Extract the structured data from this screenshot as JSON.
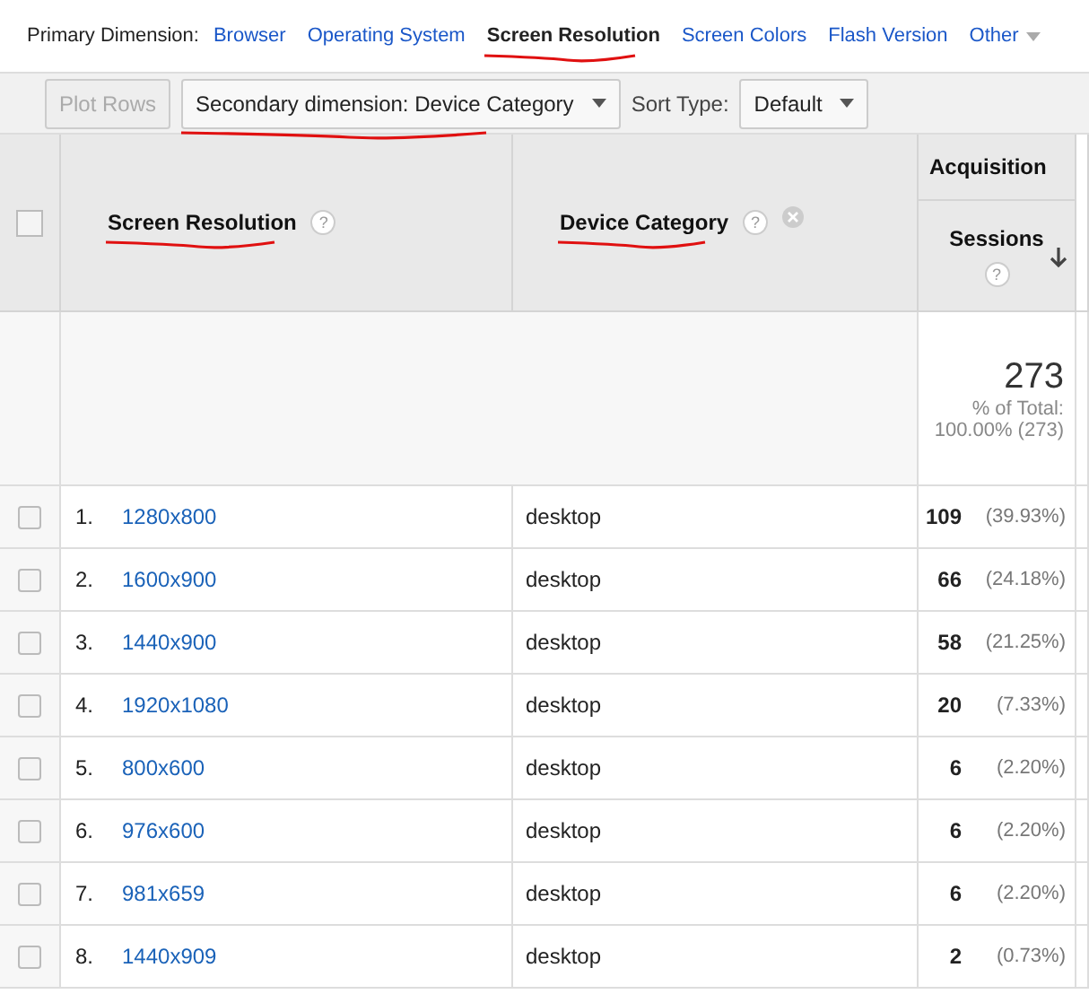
{
  "primary_dimension": {
    "label": "Primary Dimension:",
    "options": [
      {
        "label": "Browser",
        "selected": false
      },
      {
        "label": "Operating System",
        "selected": false
      },
      {
        "label": "Screen Resolution",
        "selected": true
      },
      {
        "label": "Screen Colors",
        "selected": false
      },
      {
        "label": "Flash Version",
        "selected": false
      },
      {
        "label": "Other",
        "selected": false
      }
    ]
  },
  "toolbar": {
    "plot_rows": {
      "label": "Plot Rows",
      "disabled": true
    },
    "secondary_dimension": "Secondary dimension: Device Category",
    "sort_type_label": "Sort Type:",
    "sort_type": "Default"
  },
  "table": {
    "select_all_checked": false,
    "columns": [
      {
        "label": "Screen Resolution",
        "help": "?"
      },
      {
        "label": "Device Category",
        "help": "?"
      }
    ],
    "group_header": "Acquisition",
    "metric_column": {
      "label": "Sessions",
      "help": "?"
    },
    "total": {
      "value": "273",
      "label": "% of Total:",
      "detail": "100.00% (273)"
    },
    "rows": [
      {
        "index": "1.",
        "resolution": "1280x800",
        "device": "desktop",
        "sessions": "109",
        "percent": "(39.93%)",
        "checked": false
      },
      {
        "index": "2.",
        "resolution": "1600x900",
        "device": "desktop",
        "sessions": "66",
        "percent": "(24.18%)",
        "checked": false
      },
      {
        "index": "3.",
        "resolution": "1440x900",
        "device": "desktop",
        "sessions": "58",
        "percent": "(21.25%)",
        "checked": false
      },
      {
        "index": "4.",
        "resolution": "1920x1080",
        "device": "desktop",
        "sessions": "20",
        "percent": "(7.33%)",
        "checked": false
      },
      {
        "index": "5.",
        "resolution": "800x600",
        "device": "desktop",
        "sessions": "6",
        "percent": "(2.20%)",
        "checked": false
      },
      {
        "index": "6.",
        "resolution": "976x600",
        "device": "desktop",
        "sessions": "6",
        "percent": "(2.20%)",
        "checked": false
      },
      {
        "index": "7.",
        "resolution": "981x659",
        "device": "desktop",
        "sessions": "6",
        "percent": "(2.20%)",
        "checked": false
      },
      {
        "index": "8.",
        "resolution": "1440x909",
        "device": "desktop",
        "sessions": "2",
        "percent": "(0.73%)",
        "checked": false
      }
    ]
  }
}
